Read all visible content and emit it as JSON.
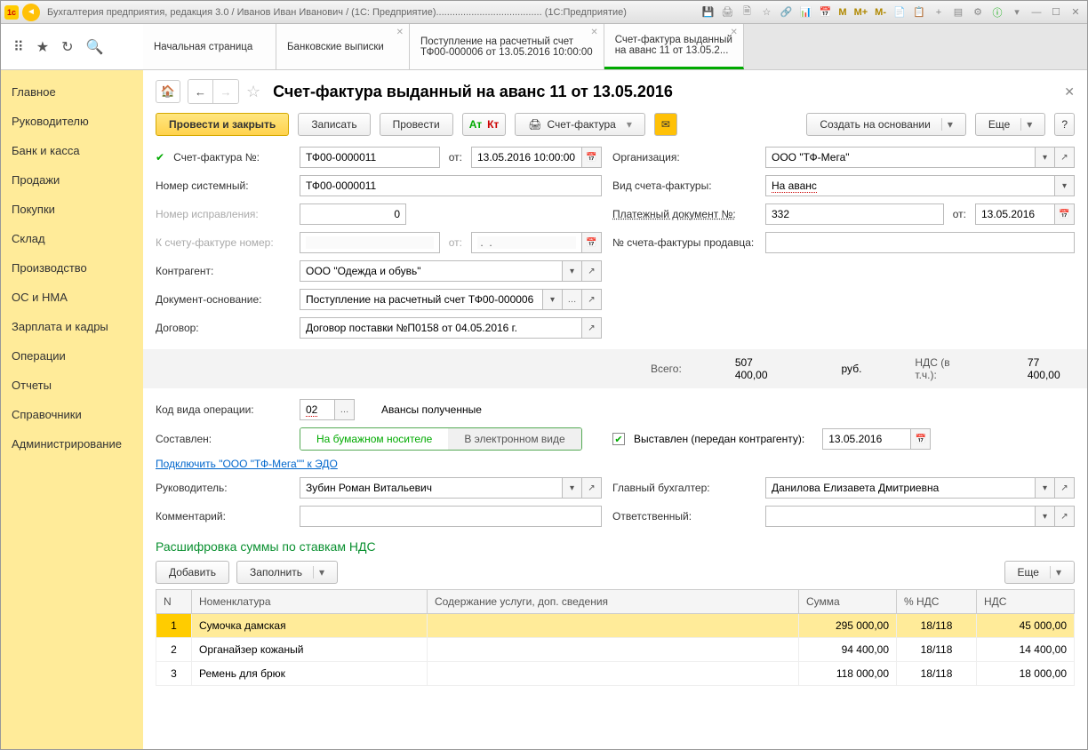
{
  "titlebar": {
    "app_title": "Бухгалтерия предприятия, редакция 3.0 / Иванов Иван Иванович / (1С: Предприятие).......................................  (1С:Предприятие)",
    "m": "M",
    "m_plus": "M+",
    "m_minus": "M-"
  },
  "tabs": [
    {
      "line1": "Начальная страница",
      "line2": "",
      "closable": false
    },
    {
      "line1": "Банковские выписки",
      "line2": "",
      "closable": true
    },
    {
      "line1": "Поступление на расчетный счет",
      "line2": "ТФ00-000006 от 13.05.2016 10:00:00",
      "closable": true
    },
    {
      "line1": "Счет-фактура выданный",
      "line2": "на аванс 11 от 13.05.2...",
      "closable": true,
      "active": true
    }
  ],
  "sidebar": {
    "items": [
      "Главное",
      "Руководителю",
      "Банк и касса",
      "Продажи",
      "Покупки",
      "Склад",
      "Производство",
      "ОС и НМА",
      "Зарплата и кадры",
      "Операции",
      "Отчеты",
      "Справочники",
      "Администрирование"
    ]
  },
  "page": {
    "title": "Счет-фактура выданный на аванс 11 от 13.05.2016",
    "actions": {
      "post_close": "Провести и закрыть",
      "write": "Записать",
      "post": "Провести",
      "print_sf": "Счет-фактура",
      "create_based": "Создать на основании",
      "more": "Еще"
    },
    "labels": {
      "sf_no": "Счет-фактура №:",
      "from": "от:",
      "org": "Организация:",
      "sys_no": "Номер системный:",
      "sf_type": "Вид счета-фактуры:",
      "corr_no": "Номер исправления:",
      "pay_doc": "Платежный документ №:",
      "to_sf_no": "К счету-фактуре номер:",
      "seller_sf": "№ счета-фактуры продавца:",
      "contragent": "Контрагент:",
      "basis_doc": "Документ-основание:",
      "contract": "Договор:",
      "op_code": "Код вида операции:",
      "op_code_text": "Авансы полученные",
      "composed": "Составлен:",
      "composed_paper": "На бумажном носителе",
      "composed_elec": "В электронном виде",
      "issued": "Выставлен (передан контрагенту):",
      "edo_link": "Подключить \"ООО \"ТФ-Мега\"\" к ЭДО",
      "head": "Руководитель:",
      "chief_acc": "Главный бухгалтер:",
      "comment": "Комментарий:",
      "responsible": "Ответственный:",
      "total": "Всего:",
      "rub": "руб.",
      "vat_incl": "НДС (в т.ч.):"
    },
    "values": {
      "sf_no": "ТФ00-0000011",
      "sf_date": "13.05.2016 10:00:00",
      "org": "ООО \"ТФ-Мега\"",
      "sys_no": "ТФ00-0000011",
      "sf_type": "На аванс",
      "corr_no": "0",
      "pay_doc_no": "332",
      "pay_doc_date": "13.05.2016",
      "to_sf_no": "",
      "to_sf_date": " .  .    ",
      "seller_sf": "",
      "contragent": "ООО \"Одежда и обувь\"",
      "basis_doc": "Поступление на расчетный счет ТФ00-000006",
      "contract": "Договор поставки №П0158 от 04.05.2016 г.",
      "op_code": "02",
      "issued_date": "13.05.2016",
      "head": "Зубин Роман Витальевич",
      "chief_acc": "Данилова Елизавета Дмитриевна",
      "comment": "",
      "responsible": "",
      "total": "507 400,00",
      "vat": "77 400,00"
    },
    "section_title": "Расшифровка суммы по ставкам НДС",
    "table_actions": {
      "add": "Добавить",
      "fill": "Заполнить",
      "more": "Еще"
    },
    "table": {
      "headers": {
        "n": "N",
        "nom": "Номенклатура",
        "desc": "Содержание услуги, доп. сведения",
        "sum": "Сумма",
        "rate": "% НДС",
        "vat": "НДС"
      },
      "rows": [
        {
          "n": "1",
          "nom": "Сумочка дамская",
          "desc": "",
          "sum": "295 000,00",
          "rate": "18/118",
          "vat": "45 000,00",
          "selected": true
        },
        {
          "n": "2",
          "nom": "Органайзер кожаный",
          "desc": "",
          "sum": "94 400,00",
          "rate": "18/118",
          "vat": "14 400,00"
        },
        {
          "n": "3",
          "nom": "Ремень для брюк",
          "desc": "",
          "sum": "118 000,00",
          "rate": "18/118",
          "vat": "18 000,00"
        }
      ]
    }
  }
}
